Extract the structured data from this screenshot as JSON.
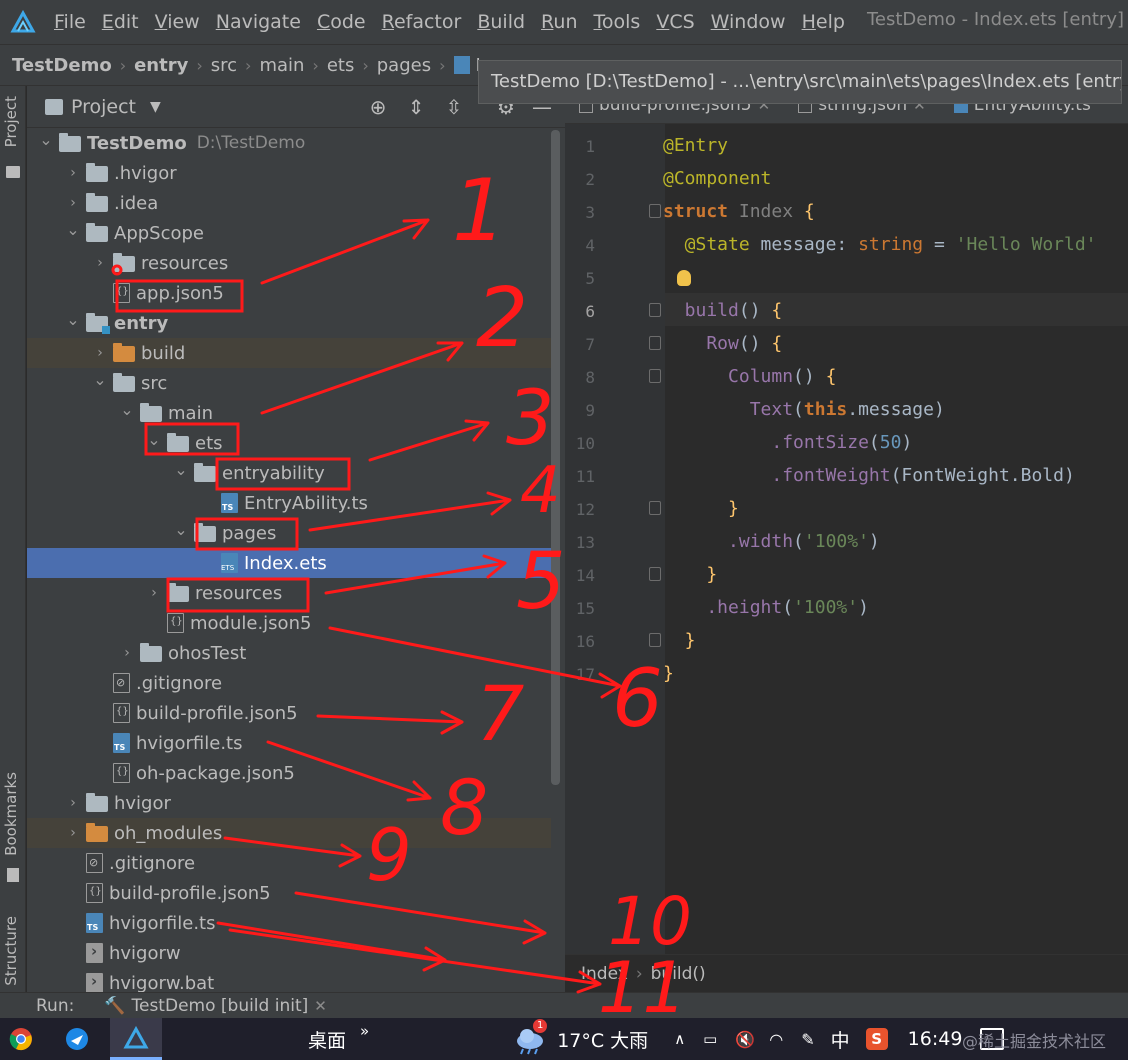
{
  "menubar": {
    "items": [
      {
        "mnemonic": "F",
        "rest": "ile"
      },
      {
        "mnemonic": "E",
        "rest": "dit"
      },
      {
        "mnemonic": "V",
        "rest": "iew"
      },
      {
        "mnemonic": "N",
        "rest": "avigate"
      },
      {
        "mnemonic": "C",
        "rest": "ode"
      },
      {
        "mnemonic": "R",
        "rest": "efactor"
      },
      {
        "mnemonic": "B",
        "rest": "uild"
      },
      {
        "mnemonic": "R",
        "rest": "un"
      },
      {
        "mnemonic": "T",
        "rest": "ools"
      },
      {
        "mnemonic": "V",
        "rest": "CS"
      },
      {
        "mnemonic": "W",
        "rest": "indow"
      },
      {
        "mnemonic": "H",
        "rest": "elp"
      }
    ],
    "window_title": "TestDemo - Index.ets [entry]"
  },
  "breadcrumb": [
    "TestDemo",
    "entry",
    "src",
    "main",
    "ets",
    "pages",
    "In"
  ],
  "tooltip": "TestDemo [D:\\TestDemo] - ...\\entry\\src\\main\\ets\\pages\\Index.ets [entry]",
  "project_panel": {
    "title": "Project",
    "tree": [
      {
        "label": "TestDemo",
        "path": "D:\\TestDemo",
        "depth": 0,
        "arrow": "expanded",
        "icon": "folder",
        "bold": true
      },
      {
        "label": ".hvigor",
        "depth": 1,
        "arrow": "collapsed",
        "icon": "folder"
      },
      {
        "label": ".idea",
        "depth": 1,
        "arrow": "collapsed",
        "icon": "folder"
      },
      {
        "label": "AppScope",
        "depth": 1,
        "arrow": "expanded",
        "icon": "folder"
      },
      {
        "label": "resources",
        "depth": 2,
        "arrow": "collapsed",
        "icon": "folder"
      },
      {
        "label": "app.json5",
        "depth": 2,
        "arrow": "none",
        "icon": "json"
      },
      {
        "label": "entry",
        "depth": 1,
        "arrow": "expanded",
        "icon": "module",
        "bold": true
      },
      {
        "label": "build",
        "depth": 2,
        "arrow": "collapsed",
        "icon": "folder-orange",
        "excluded": true
      },
      {
        "label": "src",
        "depth": 2,
        "arrow": "expanded",
        "icon": "folder"
      },
      {
        "label": "main",
        "depth": 3,
        "arrow": "expanded",
        "icon": "folder"
      },
      {
        "label": "ets",
        "depth": 4,
        "arrow": "expanded",
        "icon": "folder"
      },
      {
        "label": "entryability",
        "depth": 5,
        "arrow": "expanded",
        "icon": "folder"
      },
      {
        "label": "EntryAbility.ts",
        "depth": 6,
        "arrow": "none",
        "icon": "ts"
      },
      {
        "label": "pages",
        "depth": 5,
        "arrow": "expanded",
        "icon": "folder"
      },
      {
        "label": "Index.ets",
        "depth": 6,
        "arrow": "none",
        "icon": "ets",
        "selected": true
      },
      {
        "label": "resources",
        "depth": 4,
        "arrow": "collapsed",
        "icon": "folder"
      },
      {
        "label": "module.json5",
        "depth": 4,
        "arrow": "none",
        "icon": "json"
      },
      {
        "label": "ohosTest",
        "depth": 3,
        "arrow": "collapsed",
        "icon": "folder"
      },
      {
        "label": ".gitignore",
        "depth": 2,
        "arrow": "none",
        "icon": "ignore"
      },
      {
        "label": "build-profile.json5",
        "depth": 2,
        "arrow": "none",
        "icon": "json"
      },
      {
        "label": "hvigorfile.ts",
        "depth": 2,
        "arrow": "none",
        "icon": "ts"
      },
      {
        "label": "oh-package.json5",
        "depth": 2,
        "arrow": "none",
        "icon": "json"
      },
      {
        "label": "hvigor",
        "depth": 1,
        "arrow": "collapsed",
        "icon": "folder"
      },
      {
        "label": "oh_modules",
        "depth": 1,
        "arrow": "collapsed",
        "icon": "folder-orange",
        "excluded": true
      },
      {
        "label": ".gitignore",
        "depth": 1,
        "arrow": "none",
        "icon": "ignore"
      },
      {
        "label": "build-profile.json5",
        "depth": 1,
        "arrow": "none",
        "icon": "json"
      },
      {
        "label": "hvigorfile.ts",
        "depth": 1,
        "arrow": "none",
        "icon": "ts"
      },
      {
        "label": "hvigorw",
        "depth": 1,
        "arrow": "none",
        "icon": "exec"
      },
      {
        "label": "hvigorw.bat",
        "depth": 1,
        "arrow": "none",
        "icon": "exec"
      }
    ]
  },
  "left_strip": {
    "project": "Project",
    "bookmarks": "Bookmarks",
    "structure": "Structure"
  },
  "editor": {
    "tabs": [
      {
        "label": "build-profile.json5",
        "icon": "json"
      },
      {
        "label": "string.json",
        "icon": "json"
      },
      {
        "label": "EntryAbility.ts",
        "icon": "ts"
      }
    ],
    "current_line": 6,
    "lines": [
      {
        "n": "1",
        "tokens": [
          {
            "t": "@Entry",
            "c": "ann"
          }
        ]
      },
      {
        "n": "2",
        "tokens": [
          {
            "t": "@Component",
            "c": "ann"
          }
        ]
      },
      {
        "n": "3",
        "tokens": [
          {
            "t": "struct ",
            "c": "kw"
          },
          {
            "t": "Index ",
            "c": "dim"
          },
          {
            "t": "{",
            "c": "fn"
          }
        ]
      },
      {
        "n": "4",
        "tokens": [
          {
            "t": "  @State ",
            "c": "ann"
          },
          {
            "t": "message",
            "c": "plain"
          },
          {
            "t": ": ",
            "c": "plain"
          },
          {
            "t": "string",
            "c": "ty"
          },
          {
            "t": " = ",
            "c": "plain"
          },
          {
            "t": "'Hello World'",
            "c": "str"
          }
        ]
      },
      {
        "n": "5",
        "tokens": []
      },
      {
        "n": "6",
        "tokens": [
          {
            "t": "  build",
            "c": "prop"
          },
          {
            "t": "() ",
            "c": "plain"
          },
          {
            "t": "{",
            "c": "fn"
          }
        ]
      },
      {
        "n": "7",
        "tokens": [
          {
            "t": "    Row",
            "c": "prop"
          },
          {
            "t": "() ",
            "c": "plain"
          },
          {
            "t": "{",
            "c": "fn"
          }
        ]
      },
      {
        "n": "8",
        "tokens": [
          {
            "t": "      Column",
            "c": "prop"
          },
          {
            "t": "() ",
            "c": "plain"
          },
          {
            "t": "{",
            "c": "fn"
          }
        ]
      },
      {
        "n": "9",
        "tokens": [
          {
            "t": "        Text",
            "c": "prop"
          },
          {
            "t": "(",
            "c": "plain"
          },
          {
            "t": "this",
            "c": "kw"
          },
          {
            "t": ".message",
            "c": "plain"
          },
          {
            "t": ")",
            "c": "plain"
          }
        ]
      },
      {
        "n": "10",
        "tokens": [
          {
            "t": "          .fontSize",
            "c": "prop"
          },
          {
            "t": "(",
            "c": "plain"
          },
          {
            "t": "50",
            "c": "num"
          },
          {
            "t": ")",
            "c": "plain"
          }
        ]
      },
      {
        "n": "11",
        "tokens": [
          {
            "t": "          .fontWeight",
            "c": "prop"
          },
          {
            "t": "(FontWeight.Bold)",
            "c": "plain"
          }
        ]
      },
      {
        "n": "12",
        "tokens": [
          {
            "t": "      }",
            "c": "fn"
          }
        ]
      },
      {
        "n": "13",
        "tokens": [
          {
            "t": "      .width",
            "c": "prop"
          },
          {
            "t": "(",
            "c": "plain"
          },
          {
            "t": "'100%'",
            "c": "str"
          },
          {
            "t": ")",
            "c": "plain"
          }
        ]
      },
      {
        "n": "14",
        "tokens": [
          {
            "t": "    }",
            "c": "fn"
          }
        ]
      },
      {
        "n": "15",
        "tokens": [
          {
            "t": "    .height",
            "c": "prop"
          },
          {
            "t": "(",
            "c": "plain"
          },
          {
            "t": "'100%'",
            "c": "str"
          },
          {
            "t": ")",
            "c": "plain"
          }
        ]
      },
      {
        "n": "16",
        "tokens": [
          {
            "t": "  }",
            "c": "fn"
          }
        ]
      },
      {
        "n": "17",
        "tokens": [
          {
            "t": "}",
            "c": "fn"
          }
        ]
      }
    ],
    "breadcrumb": [
      "Index",
      "build()"
    ]
  },
  "runbar": {
    "label": "Run:",
    "tab": "TestDemo [build init]"
  },
  "taskbar": {
    "desktop": "桌面",
    "chevron": "»",
    "weather_badge": "1",
    "weather": "17°C 大雨",
    "ime": "中",
    "time": "16:49",
    "watermark": "@稀土掘金技术社区"
  },
  "annotations": [
    "1",
    "2",
    "3",
    "4",
    "5",
    "6",
    "7",
    "8",
    "9",
    "10",
    "11"
  ],
  "colors": {
    "accent": "#4b6eaf",
    "annotation": "#ff1a1a",
    "background": "#2b2b2b",
    "panel": "#3c3f41"
  }
}
